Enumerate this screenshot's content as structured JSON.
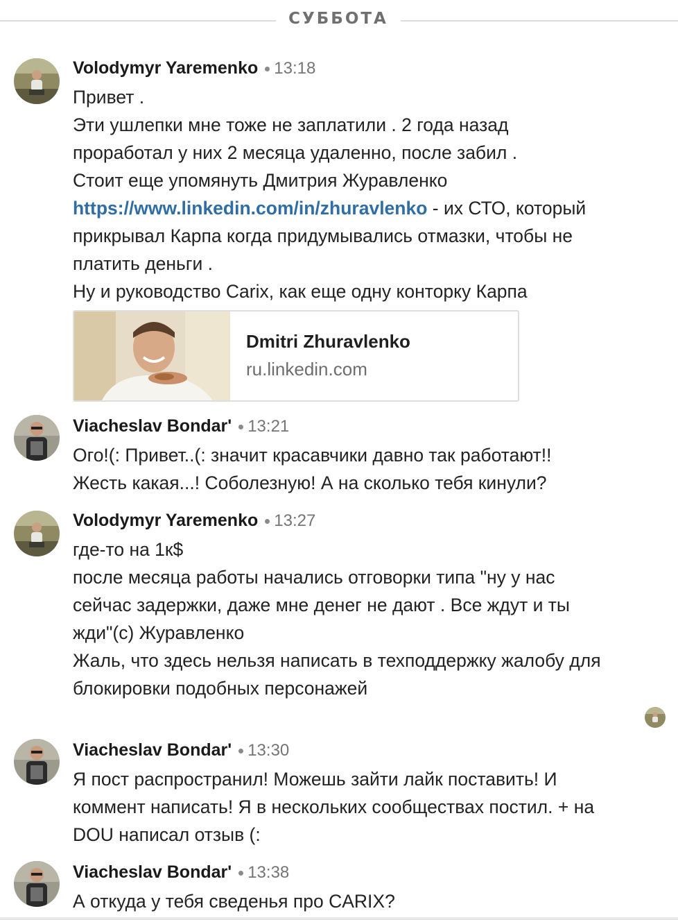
{
  "day_separator": "СУББОТА",
  "messages": [
    {
      "author": "Volodymyr Yaremenko",
      "time": "13:18",
      "avatar_icon": "user-avatar-photo",
      "lines": [
        "Привет .",
        "Эти ушлепки мне тоже не заплатили . 2 года назад",
        "проработал у них 2 месяца удаленно, после забил .",
        "Стоит еще упомянуть Дмитрия Журавленко"
      ],
      "link_text": "https://www.linkedin.com/in/zhuravlenko",
      "link_tail": " - их СТО, который",
      "lines_after": [
        "прикрывал Карпа когда придумывались отмазки, чтобы не",
        "платить деньги .",
        "Ну и руководство Carix, как еще одну конторку Карпа"
      ],
      "preview": {
        "title": "Dmitri Zhuravlenko",
        "domain": "ru.linkedin.com"
      }
    },
    {
      "author": "Viacheslav Bondar'",
      "time": "13:21",
      "avatar_icon": "user-avatar-photo",
      "lines": [
        "Ого!(: Привет..(: значит красавчики давно так работают!!",
        "Жесть какая...! Соболезную! А на сколько тебя кинули?"
      ]
    },
    {
      "author": "Volodymyr Yaremenko",
      "time": "13:27",
      "avatar_icon": "user-avatar-photo",
      "lines": [
        "где-то на 1к$",
        "после месяца работы начались отговорки типа \"ну у нас",
        "сейчас задержки, даже мне денег не дают . Все ждут и ты",
        "жди\"(с) Журавленко",
        "Жаль, что здесь нельзя написать в техподдержку жалобу для",
        "блокировки подобных персонажей"
      ]
    },
    {
      "author": "Viacheslav Bondar'",
      "time": "13:30",
      "avatar_icon": "user-avatar-photo",
      "lines": [
        "Я пост распространил! Можешь зайти лайк поставить! И",
        "коммент написать! Я в нескольких сообществах постил. + на",
        "DOU написал отзыв (:"
      ]
    },
    {
      "author": "Viacheslav Bondar'",
      "time": "13:38",
      "avatar_icon": "user-avatar-photo",
      "lines": [
        "А откуда у тебя сведенья про CARIX?"
      ]
    }
  ],
  "colors": {
    "link": "#2f6ea5",
    "meta": "#757575",
    "separator_line": "#dcdcdc"
  }
}
